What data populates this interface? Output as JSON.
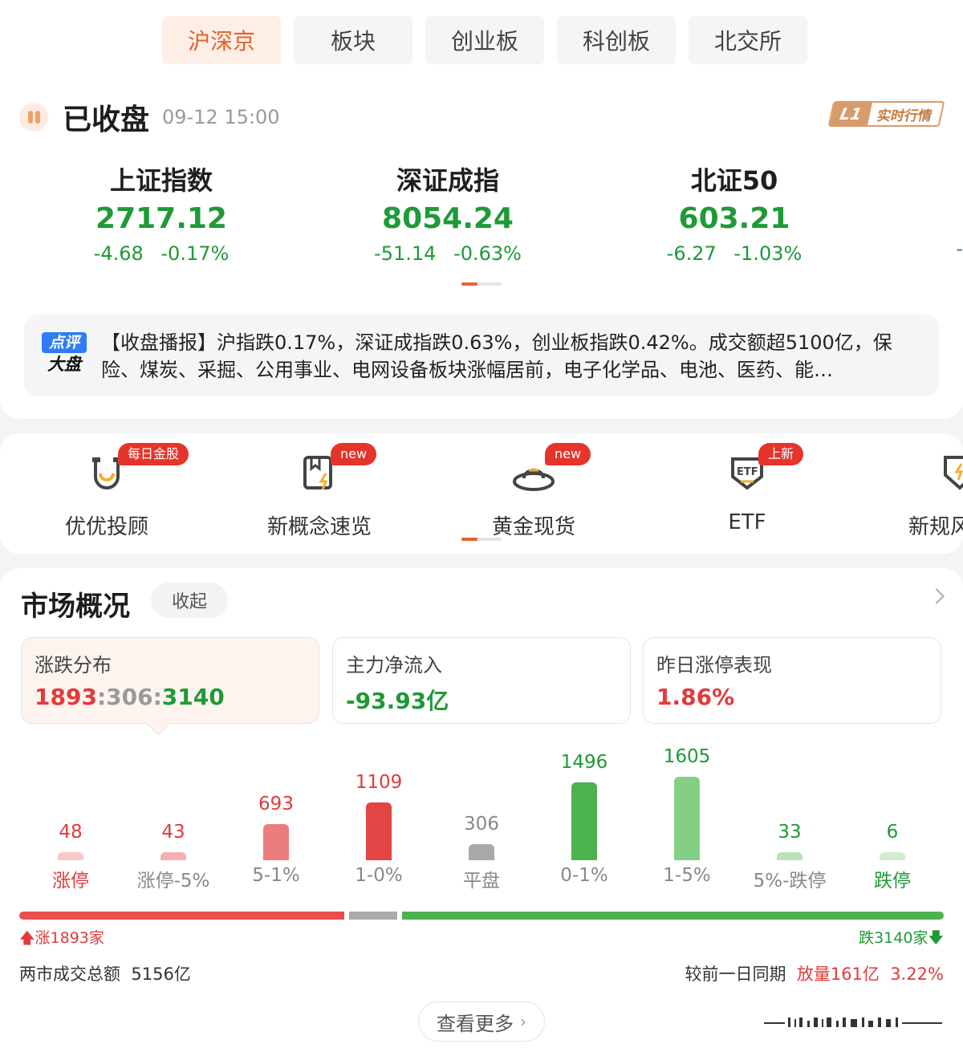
{
  "tabs": [
    "沪深京",
    "板块",
    "创业板",
    "科创板",
    "北交所"
  ],
  "status": {
    "title": "已收盘",
    "time": "09-12 15:00",
    "badge_l1": "L1",
    "badge_text": "实时行情"
  },
  "indices": [
    {
      "name": "上证指数",
      "value": "2717.12",
      "change": "-4.68 -0.17%"
    },
    {
      "name": "深证成指",
      "value": "8054.24",
      "change": "-51.14 -0.63%"
    },
    {
      "name": "北证50",
      "value": "603.21",
      "change": "-6.27 -1.03%"
    }
  ],
  "index_edge": "-",
  "news": {
    "logo_top": "点评",
    "logo_bottom": "大盘",
    "text": "【收盘播报】沪指跌0.17%，深证成指跌0.63%，创业板指跌0.42%。成交额超5100亿，保险、煤炭、采掘、公用事业、电网设备板块涨幅居前，电子化学品、电池、医药、能…"
  },
  "shortcuts": [
    {
      "label": "优优投顾",
      "badge": "每日金股",
      "icon": "magnet-icon"
    },
    {
      "label": "新概念速览",
      "badge": "new",
      "icon": "book-bolt-icon"
    },
    {
      "label": "黄金现货",
      "badge": "new",
      "icon": "gold-ingot-icon"
    },
    {
      "label": "ETF",
      "badge": "上新",
      "icon": "etf-shield-icon"
    },
    {
      "label": "新规风",
      "badge": "",
      "icon": "shield-bolt-icon"
    }
  ],
  "market": {
    "title": "市场概况",
    "collapse": "收起",
    "cards": [
      {
        "title": "涨跌分布",
        "up": "1893",
        "flat": "306",
        "down": "3140",
        "sep": ":"
      },
      {
        "title": "主力净流入",
        "value": "-93.93亿"
      },
      {
        "title": "昨日涨停表现",
        "value": "1.86%"
      }
    ],
    "distribution": [
      {
        "label": "涨停",
        "count": 48,
        "color": "#f6c8c8"
      },
      {
        "label": "涨停-5%",
        "count": 43,
        "color": "#f2b1b1"
      },
      {
        "label": "5-1%",
        "count": 693,
        "color": "#ec7d7d"
      },
      {
        "label": "1-0%",
        "count": 1109,
        "color": "#e34545"
      },
      {
        "label": "平盘",
        "count": 306,
        "color": "#a8a8a8"
      },
      {
        "label": "0-1%",
        "count": 1496,
        "color": "#4db24d"
      },
      {
        "label": "1-5%",
        "count": 1605,
        "color": "#84cf84"
      },
      {
        "label": "5%-跌停",
        "count": 33,
        "color": "#b9e2b9"
      },
      {
        "label": "跌停",
        "count": 6,
        "color": "#d2ecd2"
      }
    ],
    "up_text": "涨1893家",
    "down_text": "跌3140家",
    "volume_label": "两市成交总额",
    "volume_value": "5156亿",
    "compare_label": "较前一日同期",
    "compare_change": "放量161亿",
    "compare_pct": "3.22%",
    "more": "查看更多"
  },
  "colors": {
    "up": "#e33a3a",
    "down": "#1e9a36",
    "accent": "#e2622b"
  }
}
